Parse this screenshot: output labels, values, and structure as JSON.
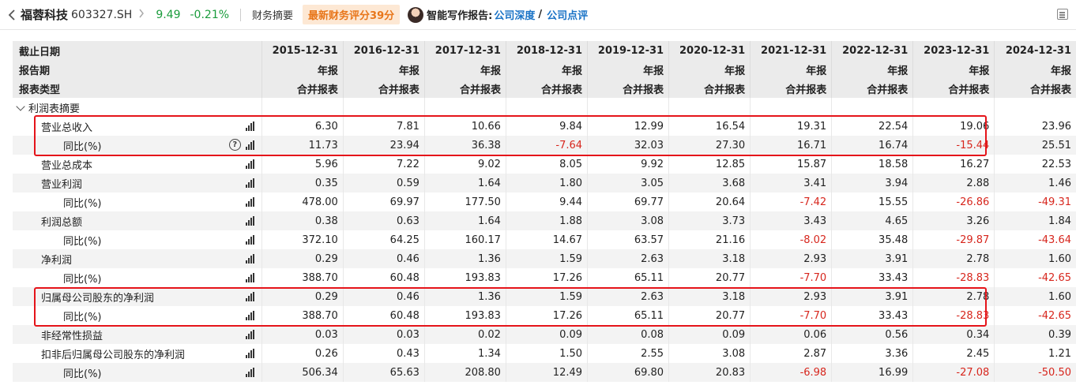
{
  "header": {
    "stock_name": "福蓉科技",
    "stock_code": "603327.SH",
    "price": "9.49",
    "change": "-0.21%",
    "summary_label": "财务摘要",
    "score_badge": "最新财务评分39分",
    "ai_label": "智能写作报告:",
    "link_deep": "公司深度",
    "slash": "/",
    "link_review": "公司点评",
    "colors": {
      "up_down_green": "#1a9c3c",
      "badge_orange": "#e8761a",
      "link_blue": "#1a73c6",
      "negative_red": "#d7261d",
      "highlight_red": "#e5141a"
    }
  },
  "table": {
    "header_rows": [
      {
        "label": "截止日期",
        "cells": [
          "2015-12-31",
          "2016-12-31",
          "2017-12-31",
          "2018-12-31",
          "2019-12-31",
          "2020-12-31",
          "2021-12-31",
          "2022-12-31",
          "2023-12-31",
          "2024-12-31"
        ]
      },
      {
        "label": "报告期",
        "cells": [
          "年报",
          "年报",
          "年报",
          "年报",
          "年报",
          "年报",
          "年报",
          "年报",
          "年报",
          "年报"
        ]
      },
      {
        "label": "报表类型",
        "cells": [
          "合并报表",
          "合并报表",
          "合并报表",
          "合并报表",
          "合并报表",
          "合并报表",
          "合并报表",
          "合并报表",
          "合并报表",
          "合并报表"
        ]
      }
    ],
    "section_label": "利润表摘要",
    "rows": [
      {
        "label": "营业总收入",
        "level": 1,
        "help": false,
        "values": [
          "6.30",
          "7.81",
          "10.66",
          "9.84",
          "12.99",
          "16.54",
          "19.31",
          "22.54",
          "19.06",
          "23.96"
        ]
      },
      {
        "label": "同比(%)",
        "level": 2,
        "help": true,
        "values": [
          "11.73",
          "23.94",
          "36.38",
          "-7.64",
          "32.03",
          "27.30",
          "16.71",
          "16.74",
          "-15.44",
          "25.51"
        ]
      },
      {
        "label": "营业总成本",
        "level": 1,
        "help": false,
        "values": [
          "5.96",
          "7.22",
          "9.02",
          "8.05",
          "9.92",
          "12.85",
          "15.87",
          "18.58",
          "16.27",
          "22.53"
        ]
      },
      {
        "label": "营业利润",
        "level": 1,
        "help": false,
        "values": [
          "0.35",
          "0.59",
          "1.64",
          "1.80",
          "3.05",
          "3.68",
          "3.41",
          "3.94",
          "2.88",
          "1.46"
        ]
      },
      {
        "label": "同比(%)",
        "level": 2,
        "help": false,
        "values": [
          "478.00",
          "69.97",
          "177.50",
          "9.44",
          "69.77",
          "20.64",
          "-7.42",
          "15.55",
          "-26.86",
          "-49.31"
        ]
      },
      {
        "label": "利润总额",
        "level": 1,
        "help": false,
        "values": [
          "0.38",
          "0.63",
          "1.64",
          "1.88",
          "3.08",
          "3.73",
          "3.43",
          "4.65",
          "3.26",
          "1.84"
        ]
      },
      {
        "label": "同比(%)",
        "level": 2,
        "help": false,
        "values": [
          "372.10",
          "64.25",
          "160.17",
          "14.67",
          "63.57",
          "21.16",
          "-8.02",
          "35.48",
          "-29.87",
          "-43.64"
        ]
      },
      {
        "label": "净利润",
        "level": 1,
        "help": false,
        "values": [
          "0.29",
          "0.46",
          "1.36",
          "1.59",
          "2.63",
          "3.18",
          "2.93",
          "3.91",
          "2.78",
          "1.60"
        ]
      },
      {
        "label": "同比(%)",
        "level": 2,
        "help": false,
        "values": [
          "388.70",
          "60.48",
          "193.83",
          "17.26",
          "65.11",
          "20.77",
          "-7.70",
          "33.43",
          "-28.83",
          "-42.65"
        ]
      },
      {
        "label": "归属母公司股东的净利润",
        "level": 1,
        "help": false,
        "values": [
          "0.29",
          "0.46",
          "1.36",
          "1.59",
          "2.63",
          "3.18",
          "2.93",
          "3.91",
          "2.78",
          "1.60"
        ]
      },
      {
        "label": "同比(%)",
        "level": 2,
        "help": false,
        "values": [
          "388.70",
          "60.48",
          "193.83",
          "17.26",
          "65.11",
          "20.77",
          "-7.70",
          "33.43",
          "-28.83",
          "-42.65"
        ]
      },
      {
        "label": "非经常性损益",
        "level": 1,
        "help": false,
        "values": [
          "0.03",
          "0.03",
          "0.02",
          "0.09",
          "0.08",
          "0.09",
          "0.06",
          "0.56",
          "0.34",
          "0.39"
        ]
      },
      {
        "label": "扣非后归属母公司股东的净利润",
        "level": 1,
        "help": false,
        "values": [
          "0.26",
          "0.43",
          "1.34",
          "1.50",
          "2.55",
          "3.08",
          "2.87",
          "3.36",
          "2.45",
          "1.21"
        ]
      },
      {
        "label": "同比(%)",
        "level": 2,
        "help": false,
        "values": [
          "506.34",
          "65.63",
          "208.80",
          "12.49",
          "69.80",
          "20.83",
          "-6.98",
          "16.99",
          "-27.08",
          "-50.50"
        ]
      }
    ]
  }
}
